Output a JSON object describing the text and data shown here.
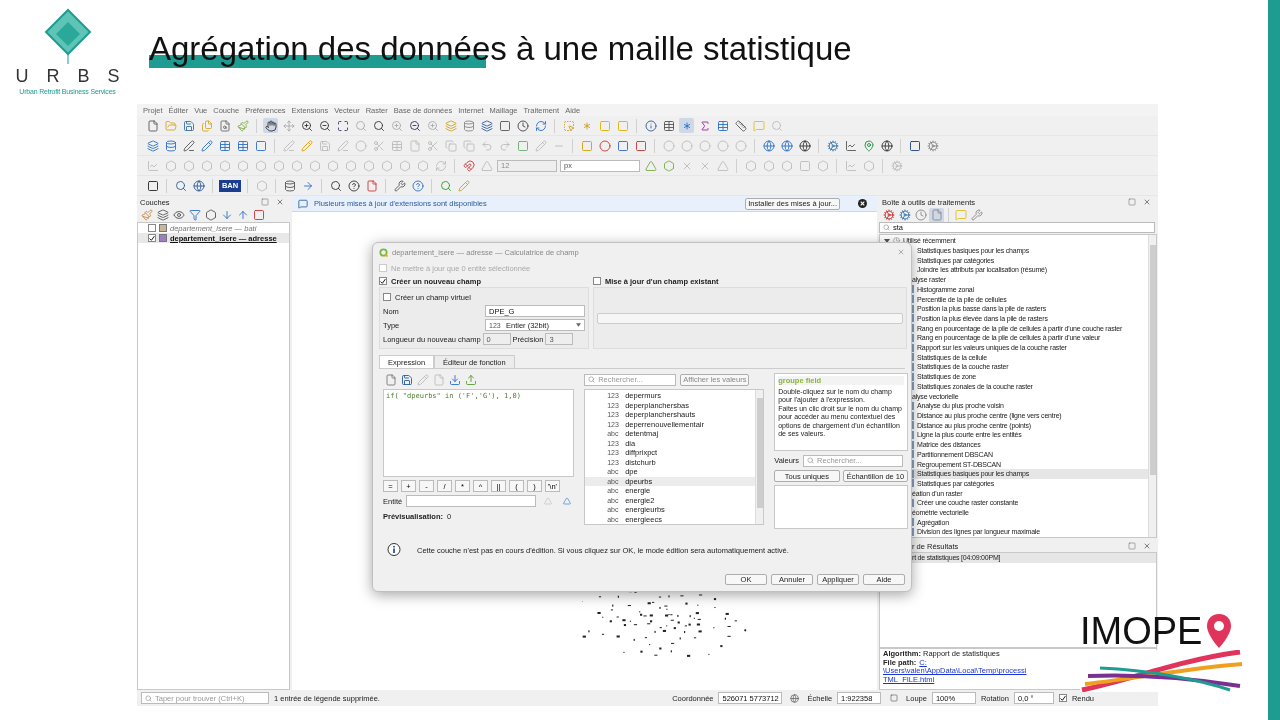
{
  "slide": {
    "title": "Agrégation des données à une maille statistique",
    "logo_left": {
      "letters": [
        "U",
        "R",
        "B",
        "S"
      ],
      "tagline": "Urban Retrofit Business Services"
    },
    "logo_right": {
      "text": "IMOPE"
    }
  },
  "qgis": {
    "menu": [
      "Projet",
      "Éditer",
      "Vue",
      "Couche",
      "Préférences",
      "Extensions",
      "Vecteur",
      "Raster",
      "Base de données",
      "Internet",
      "Maillage",
      "Traitement",
      "Aide"
    ],
    "toolbar_fields": {
      "snap_size": "12",
      "snap_unit": "px",
      "ban_label": "BAN"
    },
    "layers_panel": {
      "title": "Couches",
      "layers": [
        {
          "name": "departement_isere — bati",
          "checked": false,
          "selected": false,
          "color": "#c8b89a"
        },
        {
          "name": "departement_isere — adresse",
          "checked": true,
          "selected": true,
          "color": "#9b7fc0"
        }
      ]
    },
    "message_bar": {
      "text": "Plusieurs mises à jour d'extensions sont disponibles",
      "button": "Installer des mises à jour..."
    },
    "dialog": {
      "title": "departement_isere — adresse — Calculatrice de champ",
      "only_selected": {
        "label": "Ne mettre à jour que 0 entité sélectionnée",
        "checked": false,
        "disabled": true
      },
      "create_new": {
        "label": "Créer un nouveau champ",
        "checked": true
      },
      "update_existing": {
        "label": "Mise à jour d'un champ existant",
        "checked": false
      },
      "virtual": {
        "label": "Créer un champ virtuel",
        "checked": false
      },
      "name": {
        "label": "Nom",
        "value": "DPE_G"
      },
      "type": {
        "label": "Type",
        "badge": "123",
        "value": "Entier (32bit)"
      },
      "length": {
        "label": "Longueur du nouveau champ",
        "value": "0"
      },
      "precision": {
        "label": "Précision",
        "value": "3"
      },
      "tabs": [
        {
          "label": "Expression",
          "selected": true
        },
        {
          "label": "Éditeur de fonction",
          "selected": false
        }
      ],
      "expression": "if( \"dpeurbs\" in ('F','G'), 1,0)",
      "operators": [
        "=",
        "+",
        "-",
        "/",
        "*",
        "^",
        "||",
        "(",
        ")",
        "'\\n'"
      ],
      "entity_label": "Entité",
      "preview": {
        "label": "Prévisualisation:",
        "value": "0"
      },
      "search_placeholder": "Rechercher...",
      "show_values": "Afficher les valeurs",
      "fields": [
        {
          "type": "123",
          "name": "depermurs",
          "selected": false
        },
        {
          "type": "123",
          "name": "deperplanchersbas",
          "selected": false
        },
        {
          "type": "123",
          "name": "deperplanchershauts",
          "selected": false
        },
        {
          "type": "123",
          "name": "deperrenouvellementair",
          "selected": false
        },
        {
          "type": "abc",
          "name": "detentmaj",
          "selected": false
        },
        {
          "type": "123",
          "name": "dia",
          "selected": false
        },
        {
          "type": "123",
          "name": "diffprixpct",
          "selected": false
        },
        {
          "type": "123",
          "name": "distchurb",
          "selected": false
        },
        {
          "type": "abc",
          "name": "dpe",
          "selected": false
        },
        {
          "type": "abc",
          "name": "dpeurbs",
          "selected": true
        },
        {
          "type": "abc",
          "name": "energie",
          "selected": false
        },
        {
          "type": "abc",
          "name": "energie2",
          "selected": false
        },
        {
          "type": "abc",
          "name": "energieurbs",
          "selected": false
        },
        {
          "type": "abc",
          "name": "energieecs",
          "selected": false
        }
      ],
      "help_title": "groupe field",
      "help_text": "Double-cliquez sur le nom du champ pour l'ajouter à l'expression.\nFaites un clic droit sur le nom du champ pour accéder au menu contextuel des options de chargement d'un échantillon de ses valeurs.",
      "values_label": "Valeurs",
      "values_placeholder": "Rechercher...",
      "values_buttons": [
        "Tous uniques",
        "Échantillon de 10"
      ],
      "info": "Cette couche n'est pas en cours d'édition. Si vous cliquez sur OK, le mode édition sera automatiquement activé.",
      "buttons": [
        "OK",
        "Annuler",
        "Appliquer",
        "Aide"
      ]
    },
    "toolbox": {
      "title": "Boîte à outils de traitements",
      "search": "sta",
      "recent": {
        "label": "Utilisé récemment",
        "expanded": true,
        "children": [
          {
            "name": "Statistiques basiques pour les champs",
            "selected": false
          },
          {
            "name": "Statistiques par catégories",
            "selected": false
          },
          {
            "name": "Joindre les attributs par localisation (résumé)",
            "selected": false
          }
        ]
      },
      "groups": [
        {
          "name": "alyse raster",
          "children": [
            {
              "name": "Histogramme zonal",
              "selected": false
            },
            {
              "name": "Percentile de la pile de cellules",
              "selected": false
            },
            {
              "name": "Position la plus basse dans la pile de rasters",
              "selected": false
            },
            {
              "name": "Position la plus élevée dans la pile de rasters",
              "selected": false
            },
            {
              "name": "Rang en pourcentage de la pile de cellules à partir d'une couche raster",
              "selected": false
            },
            {
              "name": "Rang en pourcentage de la pile de cellules à partir d'une valeur",
              "selected": false
            },
            {
              "name": "Rapport sur les valeurs uniques de la couche raster",
              "selected": false
            },
            {
              "name": "Statistiques de la cellule",
              "selected": false
            },
            {
              "name": "Statistiques de la couche raster",
              "selected": false
            },
            {
              "name": "Statistiques de zone",
              "selected": false
            },
            {
              "name": "Statistiques zonales de la couche raster",
              "selected": false
            }
          ]
        },
        {
          "name": "alyse vectorielle",
          "children": [
            {
              "name": "Analyse du plus proche voisin",
              "selected": false
            },
            {
              "name": "Distance au plus proche centre (ligne vers centre)",
              "selected": false
            },
            {
              "name": "Distance au plus proche centre (points)",
              "selected": false
            },
            {
              "name": "Ligne la plus courte entre les entités",
              "selected": false
            },
            {
              "name": "Matrice des distances",
              "selected": false
            },
            {
              "name": "Partitionnement DBSCAN",
              "selected": false
            },
            {
              "name": "Regroupement ST-DBSCAN",
              "selected": false
            },
            {
              "name": "Statistiques basiques pour les champs",
              "selected": true
            },
            {
              "name": "Statistiques par catégories",
              "selected": false
            }
          ]
        },
        {
          "name": "éation d'un raster",
          "children": [
            {
              "name": "Créer une couche raster constante",
              "selected": false
            }
          ]
        },
        {
          "name": "éométrie vectorielle",
          "children": [
            {
              "name": "Agrégation",
              "selected": false
            },
            {
              "name": "Division des lignes par longueur maximale",
              "selected": false
            }
          ]
        }
      ]
    },
    "results": {
      "title": "r de Résultats",
      "entries": [
        {
          "label": "rt de statistiques [04:09:00PM]",
          "selected": true
        }
      ],
      "algorithm_label": "Algorithm:",
      "algorithm": "Rapport de statistiques",
      "path_label": "File path:",
      "path_lines": [
        "C:",
        "\\Users\\valen\\AppData\\Local\\Temp\\processi",
        "TML_FILE.html"
      ]
    },
    "status": {
      "search_placeholder": "Taper pour trouver (Ctrl+K)",
      "message": "1 entrée de légende supprimée.",
      "coord_label": "Coordonnée",
      "coord": "526071  5773712",
      "scale_label": "Échelle",
      "scale": "1:922358",
      "zoom_label": "Loupe",
      "zoom": "100%",
      "rotation_label": "Rotation",
      "rotation": "0,0 °",
      "render_label": "Rendu",
      "render": true
    }
  }
}
